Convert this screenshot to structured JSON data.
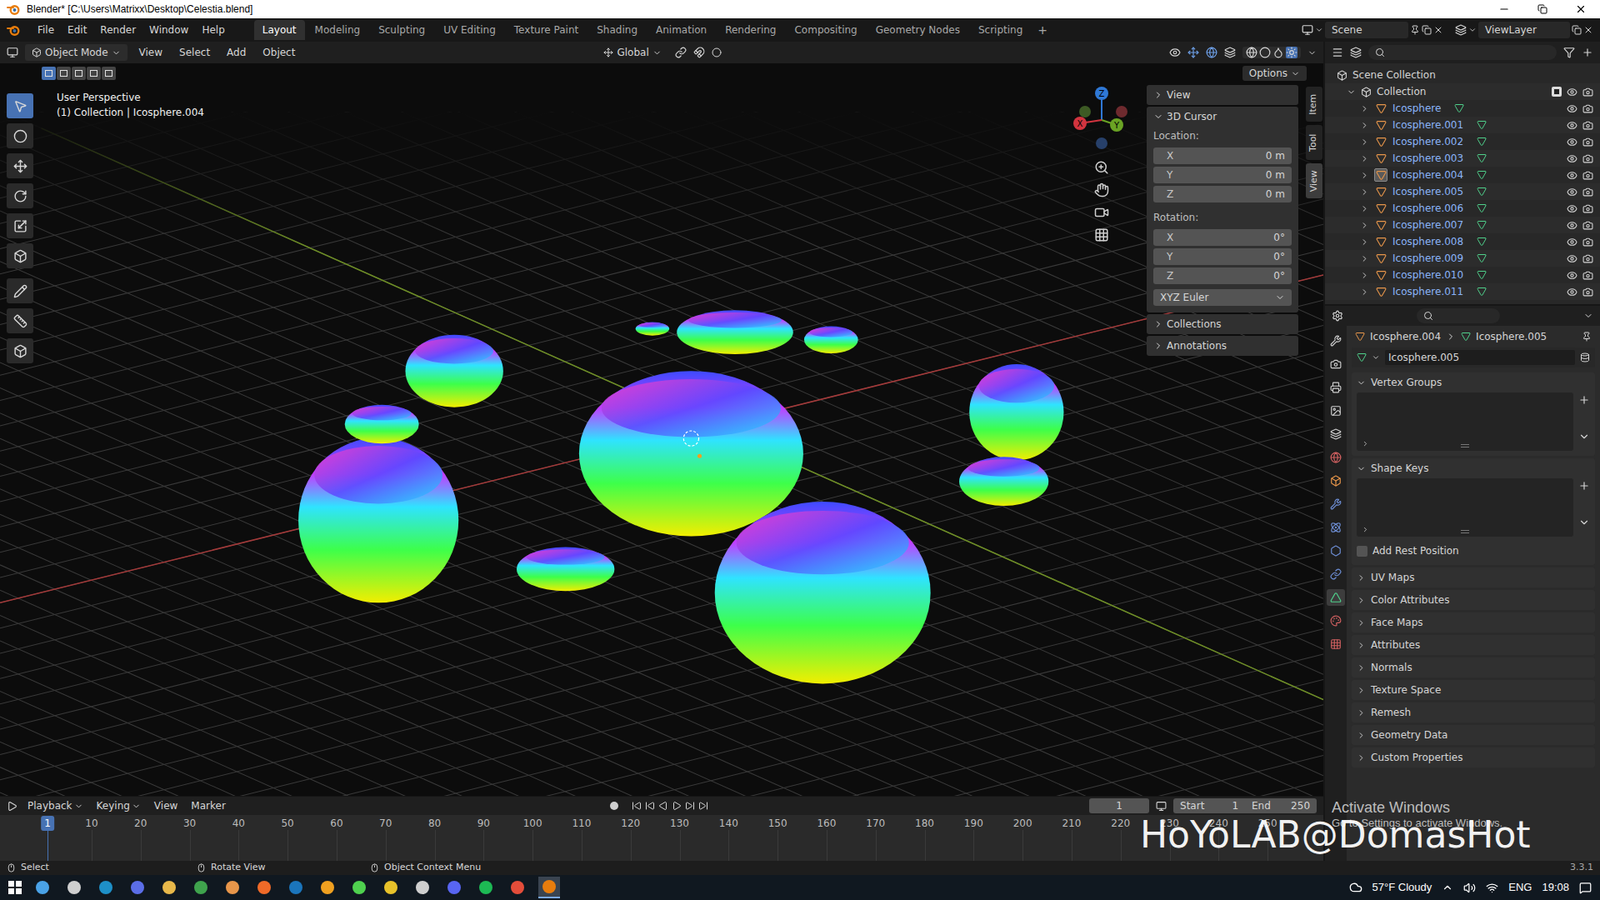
{
  "window": {
    "title": "Blender* [C:\\Users\\Matrixx\\Desktop\\Celestia.blend]"
  },
  "menu": [
    "File",
    "Edit",
    "Render",
    "Window",
    "Help"
  ],
  "workspaces": [
    {
      "label": "Layout",
      "selected": true
    },
    {
      "label": "Modeling",
      "selected": false
    },
    {
      "label": "Sculpting",
      "selected": false
    },
    {
      "label": "UV Editing",
      "selected": false
    },
    {
      "label": "Texture Paint",
      "selected": false
    },
    {
      "label": "Shading",
      "selected": false
    },
    {
      "label": "Animation",
      "selected": false
    },
    {
      "label": "Rendering",
      "selected": false
    },
    {
      "label": "Compositing",
      "selected": false
    },
    {
      "label": "Geometry Nodes",
      "selected": false
    },
    {
      "label": "Scripting",
      "selected": false
    }
  ],
  "add_workspace": "+",
  "scene": "Scene",
  "view_layer": "ViewLayer",
  "viewport": {
    "mode": "Object Mode",
    "menus": [
      "View",
      "Select",
      "Add",
      "Object"
    ],
    "orientation": "Global",
    "options": "Options",
    "select_modes": [
      {
        "selected": true
      },
      {
        "selected": false
      },
      {
        "selected": false
      },
      {
        "selected": false
      },
      {
        "selected": false
      }
    ],
    "overlay_title": "User Perspective",
    "overlay_subtitle": "(1) Collection | Icosphere.004",
    "gizmo": {
      "x": "X",
      "y": "Y",
      "z": "Z"
    }
  },
  "sidebar": {
    "tabs": [
      {
        "label": "Item",
        "selected": false
      },
      {
        "label": "Tool",
        "selected": false
      },
      {
        "label": "View",
        "selected": true
      }
    ],
    "panels": [
      {
        "title": "View",
        "expanded": false
      },
      {
        "title": "3D Cursor",
        "expanded": true
      },
      {
        "title": "Collections",
        "expanded": false
      },
      {
        "title": "Annotations",
        "expanded": false
      }
    ],
    "cursor": {
      "location_label": "Location:",
      "location": [
        {
          "axis": "X",
          "value": "0 m"
        },
        {
          "axis": "Y",
          "value": "0 m"
        },
        {
          "axis": "Z",
          "value": "0 m"
        }
      ],
      "rotation_label": "Rotation:",
      "rotation": [
        {
          "axis": "X",
          "value": "0°"
        },
        {
          "axis": "Y",
          "value": "0°"
        },
        {
          "axis": "Z",
          "value": "0°"
        }
      ],
      "rotation_mode": "XYZ Euler"
    }
  },
  "outliner": {
    "root": "Scene Collection",
    "collection": {
      "name": "Collection",
      "checked": true
    },
    "objects": [
      {
        "name": "Icosphere",
        "active": false
      },
      {
        "name": "Icosphere.001",
        "active": false
      },
      {
        "name": "Icosphere.002",
        "active": false
      },
      {
        "name": "Icosphere.003",
        "active": false
      },
      {
        "name": "Icosphere.004",
        "active": true
      },
      {
        "name": "Icosphere.005",
        "active": false
      },
      {
        "name": "Icosphere.006",
        "active": false
      },
      {
        "name": "Icosphere.007",
        "active": false
      },
      {
        "name": "Icosphere.008",
        "active": false
      },
      {
        "name": "Icosphere.009",
        "active": false
      },
      {
        "name": "Icosphere.010",
        "active": false
      },
      {
        "name": "Icosphere.011",
        "active": false
      }
    ]
  },
  "properties": {
    "breadcrumb": [
      "Icosphere.004",
      "Icosphere.005"
    ],
    "mesh": "Icosphere.005",
    "panels": [
      {
        "title": "Vertex Groups",
        "expanded": true,
        "kind": "list"
      },
      {
        "title": "Shape Keys",
        "expanded": true,
        "kind": "list",
        "checkbox": {
          "label": "Add Rest Position",
          "checked": false
        }
      },
      {
        "title": "UV Maps",
        "expanded": false,
        "kind": "header"
      },
      {
        "title": "Color Attributes",
        "expanded": false,
        "kind": "header"
      },
      {
        "title": "Face Maps",
        "expanded": false,
        "kind": "header"
      },
      {
        "title": "Attributes",
        "expanded": false,
        "kind": "header"
      },
      {
        "title": "Normals",
        "expanded": false,
        "kind": "header"
      },
      {
        "title": "Texture Space",
        "expanded": false,
        "kind": "header"
      },
      {
        "title": "Remesh",
        "expanded": false,
        "kind": "header"
      },
      {
        "title": "Geometry Data",
        "expanded": false,
        "kind": "header"
      },
      {
        "title": "Custom Properties",
        "expanded": false,
        "kind": "header"
      }
    ]
  },
  "timeline": {
    "menus": [
      {
        "label": "Playback",
        "dropdown": true
      },
      {
        "label": "Keying",
        "dropdown": true
      },
      {
        "label": "View",
        "dropdown": false
      },
      {
        "label": "Marker",
        "dropdown": false
      }
    ],
    "current_frame": "1",
    "start_label": "Start",
    "start": "1",
    "end_label": "End",
    "end": "250",
    "ticks": [
      "1",
      "10",
      "20",
      "30",
      "40",
      "50",
      "60",
      "70",
      "80",
      "90",
      "100",
      "110",
      "120",
      "130",
      "140",
      "150",
      "160",
      "170",
      "180",
      "190",
      "200",
      "210",
      "220",
      "230",
      "240",
      "250"
    ]
  },
  "status_bar": {
    "hints": [
      "Select",
      "Rotate View",
      "Object Context Menu"
    ],
    "version": "3.3.1"
  },
  "taskbar": {
    "weather": "57°F Cloudy",
    "language": "ENG",
    "time": "19:08"
  },
  "watermark": "HoYoLAB@DomasHot",
  "activation": {
    "title": "Activate Windows",
    "subtitle": "Go to Settings to activate Windows."
  }
}
